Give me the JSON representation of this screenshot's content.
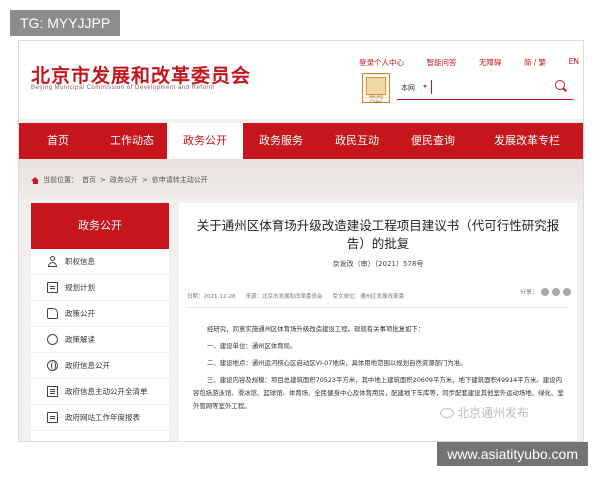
{
  "watermark": {
    "tag": "TG: MYYJJPP",
    "site": "www.asiatityubo.com",
    "wechat": "北京通州发布"
  },
  "header": {
    "logo_cn": "北京市发展和改革委员会",
    "logo_en": "Beijing Municipal Commission of Development and Reform",
    "toplinks": [
      "登录个人中心",
      "智能问答",
      "无障碍",
      "简 / 繁",
      "EN"
    ],
    "badge_text": "Beijing China",
    "search": {
      "scope": "本网",
      "placeholder": ""
    }
  },
  "nav": {
    "items": [
      "首页",
      "工作动态",
      "政务公开",
      "政务服务",
      "政民互动",
      "便民查询",
      "发展改革专栏"
    ],
    "active": "政务公开"
  },
  "breadcrumb": {
    "prefix": "当前位置：",
    "items": [
      "首页",
      "政务公开",
      "依申请转主动公开"
    ],
    "separator": ">"
  },
  "sidebar": {
    "title": "政务公开",
    "items": [
      {
        "label": "职权信息",
        "icon": "person-icon"
      },
      {
        "label": "规划计划",
        "icon": "document-icon"
      },
      {
        "label": "政策公开",
        "icon": "thumb-icon"
      },
      {
        "label": "政策解读",
        "icon": "chat-icon"
      },
      {
        "label": "政府信息公开",
        "icon": "globe-icon"
      },
      {
        "label": "政府信息主动公开全清单",
        "icon": "list-icon"
      },
      {
        "label": "政府网站工作年度报表",
        "icon": "document-icon"
      }
    ]
  },
  "article": {
    "title": "关于通州区体育场升级改造建设工程项目建议书（代可行性研究报告）的批复",
    "doc_no": "京发改（审）〔2021〕578号",
    "meta": {
      "date": "日期：2021-12-28",
      "source": "来源：北京市发展和改革委员会",
      "agency": "受文单位：通州区发展改革委"
    },
    "share_label": "分享：",
    "paragraphs": [
      "经研究，同意实施通州区体育场升级改造建设工程。现就有关事项批复如下：",
      "一、建设单位：通州区体育局。",
      "二、建设地点：通州运河核心区启动区VI-07地块，具体用地范围以规划自然资源部门为准。",
      "三、建设内容及规模：项目总建筑面积70523平方米，其中地上建筑面积20609平方米，地下建筑面积49914平方米。建设内容包括游泳馆、滑冰馆、篮球馆、体育场、全民健身中心及体育用房，配建地下车库等，同步配套建设其他室外运动场地、绿化、室外管网等室外工程。"
    ]
  },
  "colors": {
    "brand": "#c4161c",
    "background": "#f2f0ef"
  }
}
